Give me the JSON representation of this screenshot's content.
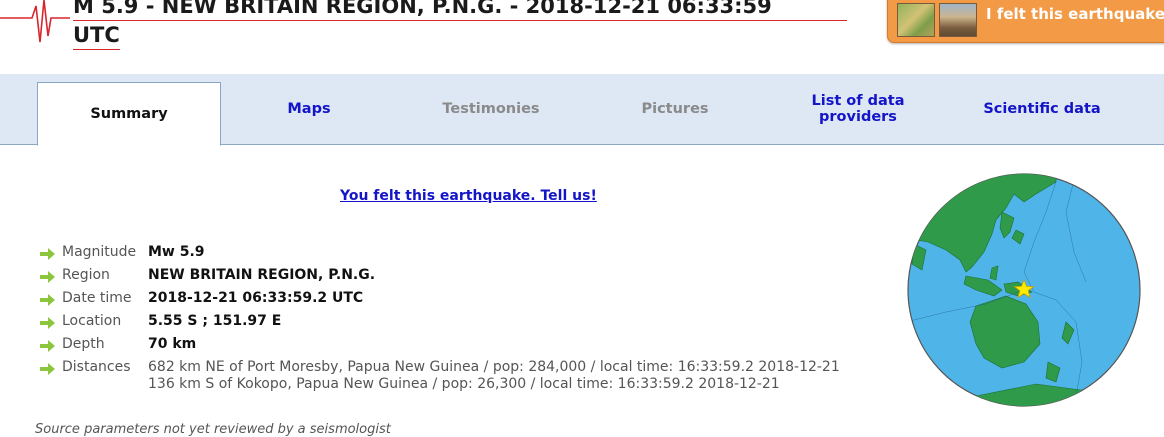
{
  "header": {
    "title_line1": "M 5.9 - NEW BRITAIN REGION, P.N.G. - 2018-12-21 06:33:59",
    "title_line2": "UTC",
    "felt_button_label": "I felt this earthquake"
  },
  "tabs": [
    {
      "label": "Summary",
      "state": "active"
    },
    {
      "label": "Maps",
      "state": "link"
    },
    {
      "label": "Testimonies",
      "state": "disabled"
    },
    {
      "label": "Pictures",
      "state": "disabled"
    },
    {
      "label": "List of data providers",
      "state": "link"
    },
    {
      "label": "Scientific data",
      "state": "link"
    }
  ],
  "felt_link": "You felt this earthquake. Tell us!",
  "parameters": [
    {
      "label": "Magnitude",
      "value": "Mw 5.9"
    },
    {
      "label": "Region",
      "value": "NEW BRITAIN REGION, P.N.G."
    },
    {
      "label": "Date time",
      "value": "2018-12-21 06:33:59.2 UTC"
    },
    {
      "label": "Location",
      "value": "5.55 S ; 151.97 E"
    },
    {
      "label": "Depth",
      "value": "70 km"
    }
  ],
  "distances": {
    "label": "Distances",
    "lines": [
      "682 km NE of Port Moresby, Papua New Guinea / pop: 284,000 / local time: 16:33:59.2 2018-12-21",
      "136 km S of Kokopo, Papua New Guinea / pop: 26,300 / local time: 16:33:59.2 2018-12-21"
    ]
  },
  "review_note": "Source parameters not yet reviewed by a seismologist",
  "colors": {
    "tab_bar_bg": "#dde8f4",
    "link_blue": "#1414c8",
    "felt_button_orange": "#f39a47",
    "title_underline_red": "#d9262b",
    "bullet_arrow_green": "#8cc63f",
    "globe_ocean": "#4fb4e8",
    "globe_land": "#2f9a4a",
    "epicenter_star": "#ffeb00"
  },
  "icons": {
    "logo": "seismogram-logo-icon",
    "bullet": "green-arrow-icon",
    "epicenter": "star-icon"
  }
}
